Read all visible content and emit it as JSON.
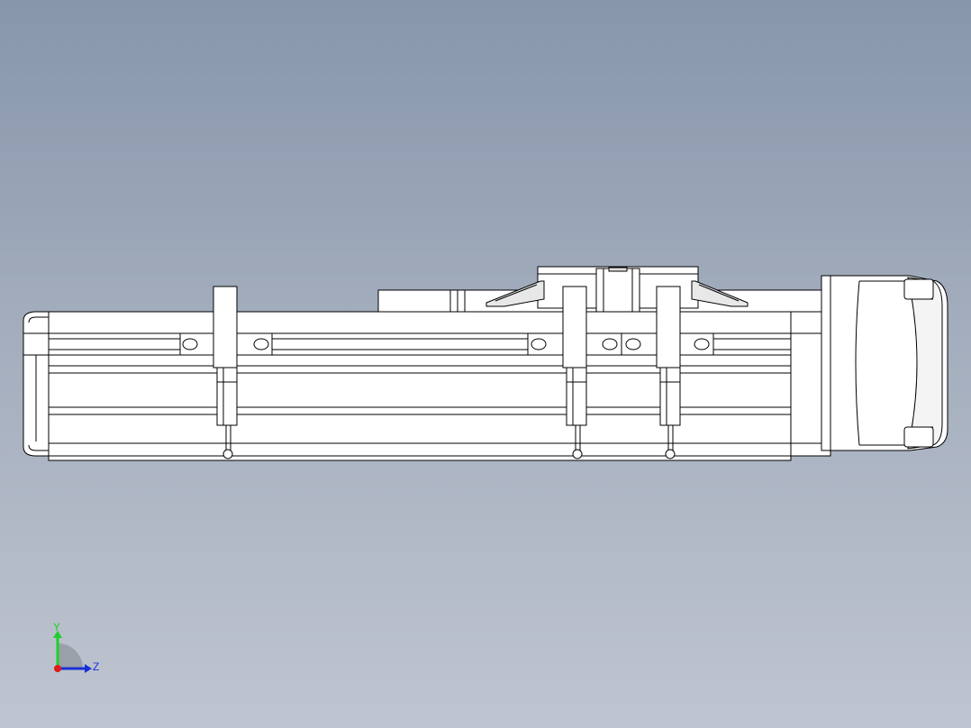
{
  "viewport": {
    "background_top": "#8796ab",
    "background_bottom": "#bfc5d0",
    "line_color": "#000000",
    "part_fill": "#ffffff",
    "shade_fill": "#e4e4e4"
  },
  "triad": {
    "y_label": "Y",
    "z_label": "Z",
    "y_color": "#1fcf2a",
    "z_color": "#1a2fd8",
    "x_color": "#e01b1b"
  },
  "assembly": {
    "components": [
      "linear-actuator-body",
      "carriage",
      "motor",
      "limit-sensor",
      "limit-sensor",
      "limit-sensor"
    ]
  }
}
